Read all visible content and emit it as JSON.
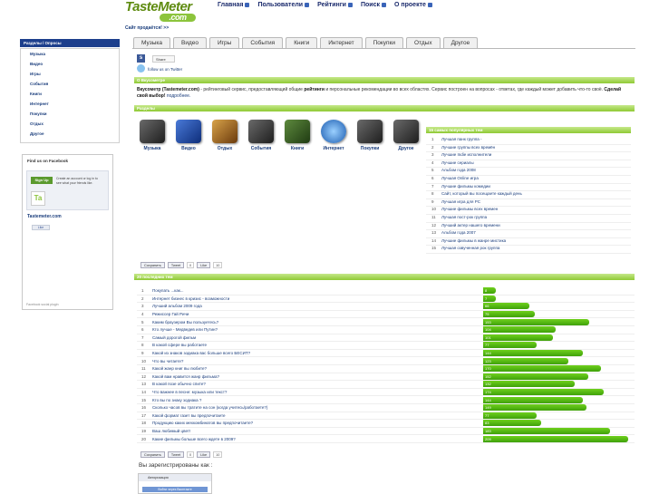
{
  "header": {
    "logo_main": "TasteMeter",
    "logo_suffix": ".com",
    "nav": [
      "Главная",
      "Пользователи",
      "Рейтинги",
      "Поиск",
      "О проекте"
    ],
    "tagline": "Сайт продаётся! >>"
  },
  "sidebar": {
    "header": "Разделы / Опросы",
    "items": [
      "Музыка",
      "Видео",
      "Игры",
      "События",
      "Книги",
      "Интернет",
      "Покупки",
      "Отдых",
      "Другое"
    ],
    "facebook": {
      "title": "Find us on Facebook",
      "signup": "Sign Up",
      "signup_text": "Create an account or log in to see what your friends like.",
      "logo": "Ta",
      "page_name": "Tastemeter.com",
      "like": "Like",
      "plugin": "Facebook social plugin"
    }
  },
  "tabs": [
    "Музыка",
    "Видео",
    "Игры",
    "События",
    "Книги",
    "Интернет",
    "Покупки",
    "Отдых",
    "Другое"
  ],
  "social": {
    "share": "Share",
    "follow": "follow us on Twitter"
  },
  "about": {
    "header": "О Вкусометре",
    "text_bold": "Вкусометр (Tastemeter.com)",
    "text_1": " - рейтинговый сервис, предоставляющий общие ",
    "text_ratings": "рейтинги",
    "text_2": " и персональные рекомендации во всех областях. Сервис построен на вопросах - ответах, где каждый может добавить что-то своё. ",
    "text_cta": "Сделай свой выбор!",
    "text_more": " подробнее."
  },
  "sections": {
    "header": "Разделы",
    "items": [
      {
        "label": "Музыка",
        "icon": "music-icon"
      },
      {
        "label": "Видео",
        "icon": "video-icon"
      },
      {
        "label": "Отдых",
        "icon": "leisure-icon"
      },
      {
        "label": "События",
        "icon": "events-icon"
      },
      {
        "label": "Книги",
        "icon": "books-icon"
      },
      {
        "label": "Интернет",
        "icon": "internet-icon"
      },
      {
        "label": "Покупки",
        "icon": "shopping-icon"
      },
      {
        "label": "Другое",
        "icon": "other-icon"
      }
    ]
  },
  "popular": {
    "header": "15 самых популярных тем",
    "items": [
      "Лучшая панк группа -",
      "Лучшие группы всех времён",
      "Лучшие Indie исполнители",
      "Лучшие сериалы",
      "Альбом года 2008",
      "Лучшая Online игра",
      "Лучшие фильмы комедии",
      "Сайт, который вы посещаете каждый день",
      "Лучшая игра для PC",
      "Лучшие фильмы всех времен",
      "Лучшая пост-рок группа",
      "Лучший актер нашего времени",
      "Альбом года 2007",
      "Лучшие фильмы в жанре мистика",
      "Лучшая озвученная рок группа"
    ]
  },
  "share_row": {
    "save": "Сохранить",
    "tweet": "Tweet",
    "tweet_count": "0",
    "like": "Like",
    "like_count": "10"
  },
  "share_row2": {
    "save": "Сохранить",
    "tweet": "Tweet",
    "tweet_count": "0",
    "like": "Like",
    "like_count": "10"
  },
  "latest": {
    "header": "20 последних тем",
    "items": [
      {
        "title": "Покупать ...как...",
        "value": 8
      },
      {
        "title": "Интернет бизнес в кризис - возможности",
        "value": 7
      },
      {
        "title": "Лучший альбом 2009 года",
        "value": 66
      },
      {
        "title": "Режиссер Гай Ричи",
        "value": 75
      },
      {
        "title": "Каким браузером Вы пользуетесь?",
        "value": 153
      },
      {
        "title": "Кто лучше - Медведев или Путин?",
        "value": 104
      },
      {
        "title": "Самый дорогой фильм",
        "value": 101
      },
      {
        "title": "В какой сфере вы работаете",
        "value": 77
      },
      {
        "title": "Какой из знаков зодиака вас больше всего БЕСИТ?",
        "value": 144
      },
      {
        "title": "Что вы читаете?",
        "value": 123
      },
      {
        "title": "Какой жанр книг вы любите?",
        "value": 170
      },
      {
        "title": "Какой вам нравится жанр фильма?",
        "value": 152
      },
      {
        "title": "В какой позе обычно спите?",
        "value": 132
      },
      {
        "title": "Что важнее в песне: музыка или текст?",
        "value": 174
      },
      {
        "title": "Кто вы по знаку зодиака ?",
        "value": 144
      },
      {
        "title": "Сколько часов вы тратите на сон (когда учитесь/работаете?)",
        "value": 149
      },
      {
        "title": "Какой формат газет вы предпочитаете",
        "value": 77
      },
      {
        "title": "Продукцию каких мехкомбинатов вы предпочитаете?",
        "value": 83
      },
      {
        "title": "Ваш любимый цвет!",
        "value": 183
      },
      {
        "title": "Какие фильмы больше всего ждете в 2009?",
        "value": 209
      }
    ]
  },
  "registered": {
    "text": "Вы зарегистрированы как :",
    "auth_header": "Авторизация",
    "auth_button": "Войти через Вконтакте"
  }
}
